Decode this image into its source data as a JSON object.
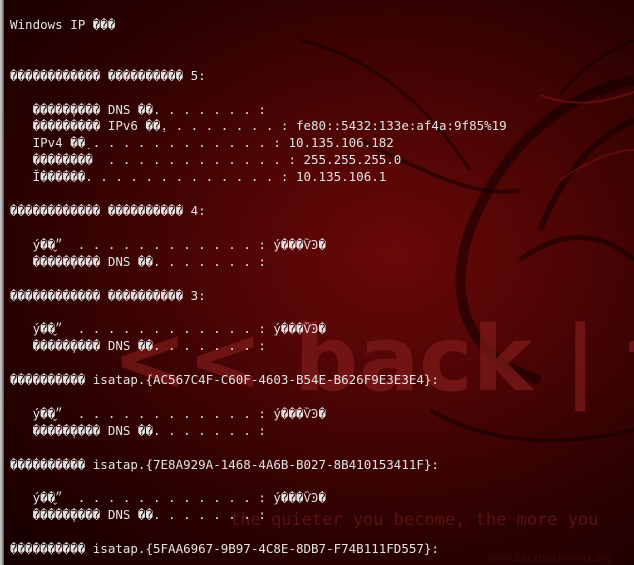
{
  "window": {
    "title": "Windows IP ���"
  },
  "colors": {
    "background": "#3a0202",
    "text": "#e4e4e4",
    "logo": "#7c1a1a"
  },
  "wallpaper": {
    "logo_text": "<< back | track",
    "tagline": "the quieter you become, the more you",
    "watermark": "www.backtrack-linux.org"
  },
  "console": {
    "lines": [
      "Windows IP ���",
      "",
      "",
      "������������ ���������� 5:",
      "",
      "   �����̹���� DNS ��׺. . . . . . . :",
      "   ��������� IPv6 ��ַ. . . . . . . . : fe80::5432:133e:af4a:9f85%19",
      "   IPv4 ��ַ . . . . . . . . . . . . : 10.135.106.182",
      "   ��������  . . . . . . . . . . . . : 255.255.255.0",
      "   Ĭ������. . . . . . . . . . . . . : 10.135.106.1",
      "",
      "������������ ���������� 4:",
      "",
      "   ý��״̬  . . . . . . . . . . . . : ý���ѶϿ�",
      "   �����̹���� DNS ��׺. . . . . . . :",
      "",
      "������������ ���������� 3:",
      "",
      "   ý��״̬  . . . . . . . . . . . . : ý���ѶϿ�",
      "   �����̹���� DNS ��׺. . . . . . . :",
      "",
      "���������� isatap.{AC567C4F-C60F-4603-B54E-B626F9E3E3E4}:",
      "",
      "   ý��״̬  . . . . . . . . . . . . : ý���ѶϿ�",
      "   �����̹���� DNS ��׺. . . . . . . :",
      "",
      "���������� isatap.{7E8A929A-1468-4A6B-B027-8B410153411F}:",
      "",
      "   ý��״̬  . . . . . . . . . . . . : ý���ѶϿ�",
      "   �����̹���� DNS ��׺. . . . . . . :",
      "",
      "���������� isatap.{5FAA6967-9B97-4C8E-8DB7-F74B111FD557}:"
    ]
  }
}
